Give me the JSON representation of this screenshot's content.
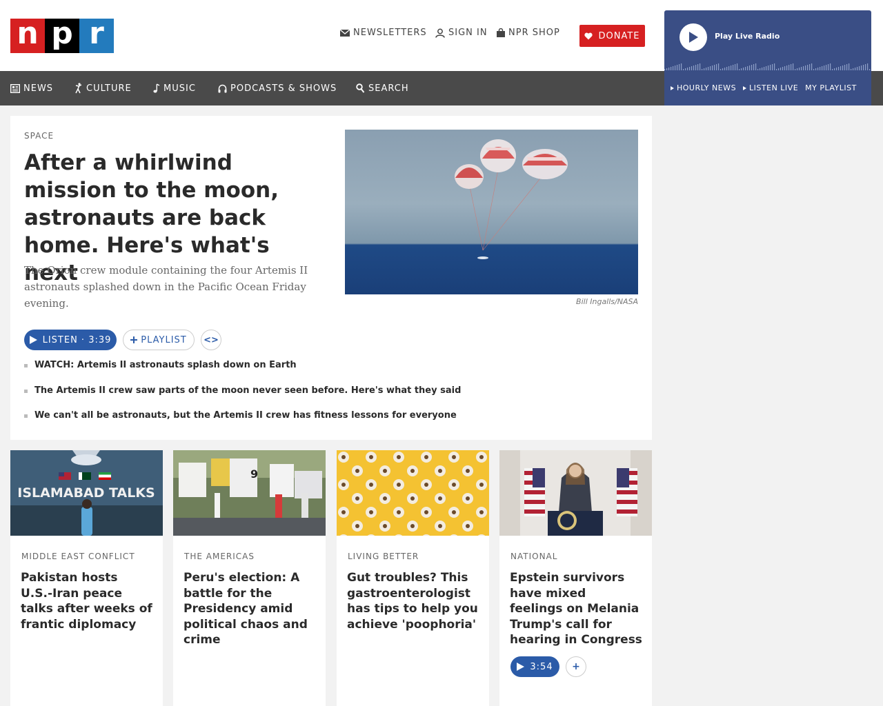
{
  "header": {
    "logo_letters": [
      "n",
      "p",
      "r"
    ],
    "newsletters": "NEWSLETTERS",
    "sign_in": "SIGN IN",
    "shop": "NPR SHOP",
    "donate": "DONATE"
  },
  "nav": {
    "items": [
      {
        "label": "NEWS",
        "icon": "newspaper-icon"
      },
      {
        "label": "CULTURE",
        "icon": "dancer-icon"
      },
      {
        "label": "MUSIC",
        "icon": "music-note-icon"
      },
      {
        "label": "PODCASTS & SHOWS",
        "icon": "headphones-icon"
      },
      {
        "label": "SEARCH",
        "icon": "search-icon"
      }
    ]
  },
  "player": {
    "play_label": "Play Live Radio",
    "hourly_news": "HOURLY NEWS",
    "listen_live": "LISTEN LIVE",
    "my_playlist": "MY PLAYLIST"
  },
  "hero": {
    "kicker": "SPACE",
    "title": "After a whirlwind mission to the moon, astronauts are back home. Here's what's next",
    "teaser": "The Orion crew module containing the four Artemis II astronauts splashed down in the Pacific Ocean Friday evening.",
    "credit": "Bill Ingalls/NASA",
    "listen_label": "LISTEN · 3:39",
    "playlist_label": "PLAYLIST",
    "embed_label": "<>",
    "related": [
      "WATCH: Artemis II astronauts splash down on Earth",
      "The Artemis II crew saw parts of the moon never seen before. Here's what they said",
      "We can't all be astronauts, but the Artemis II crew has fitness lessons for everyone"
    ]
  },
  "cards": [
    {
      "kicker": "MIDDLE EAST CONFLICT",
      "title": "Pakistan hosts U.S.-Iran peace talks after weeks of frantic diplomacy",
      "image_text": "ISLAMABAD TALKS"
    },
    {
      "kicker": "THE AMERICAS",
      "title": "Peru's election: A battle for the Presidency amid political chaos and crime"
    },
    {
      "kicker": "LIVING BETTER",
      "title": "Gut troubles? This gastroenterologist has tips to help you achieve 'poophoria'"
    },
    {
      "kicker": "NATIONAL",
      "title": "Epstein survivors have mixed feelings on Melania Trump's call for hearing in Congress",
      "listen_label": "3:54",
      "plus_label": "+"
    }
  ],
  "colors": {
    "npr_red": "#d62021",
    "npr_black": "#000000",
    "npr_blue": "#237bbd",
    "nav_bg": "#4a4a4a",
    "player_bg": "#3a4e85",
    "button_blue": "#2b5ba8"
  }
}
